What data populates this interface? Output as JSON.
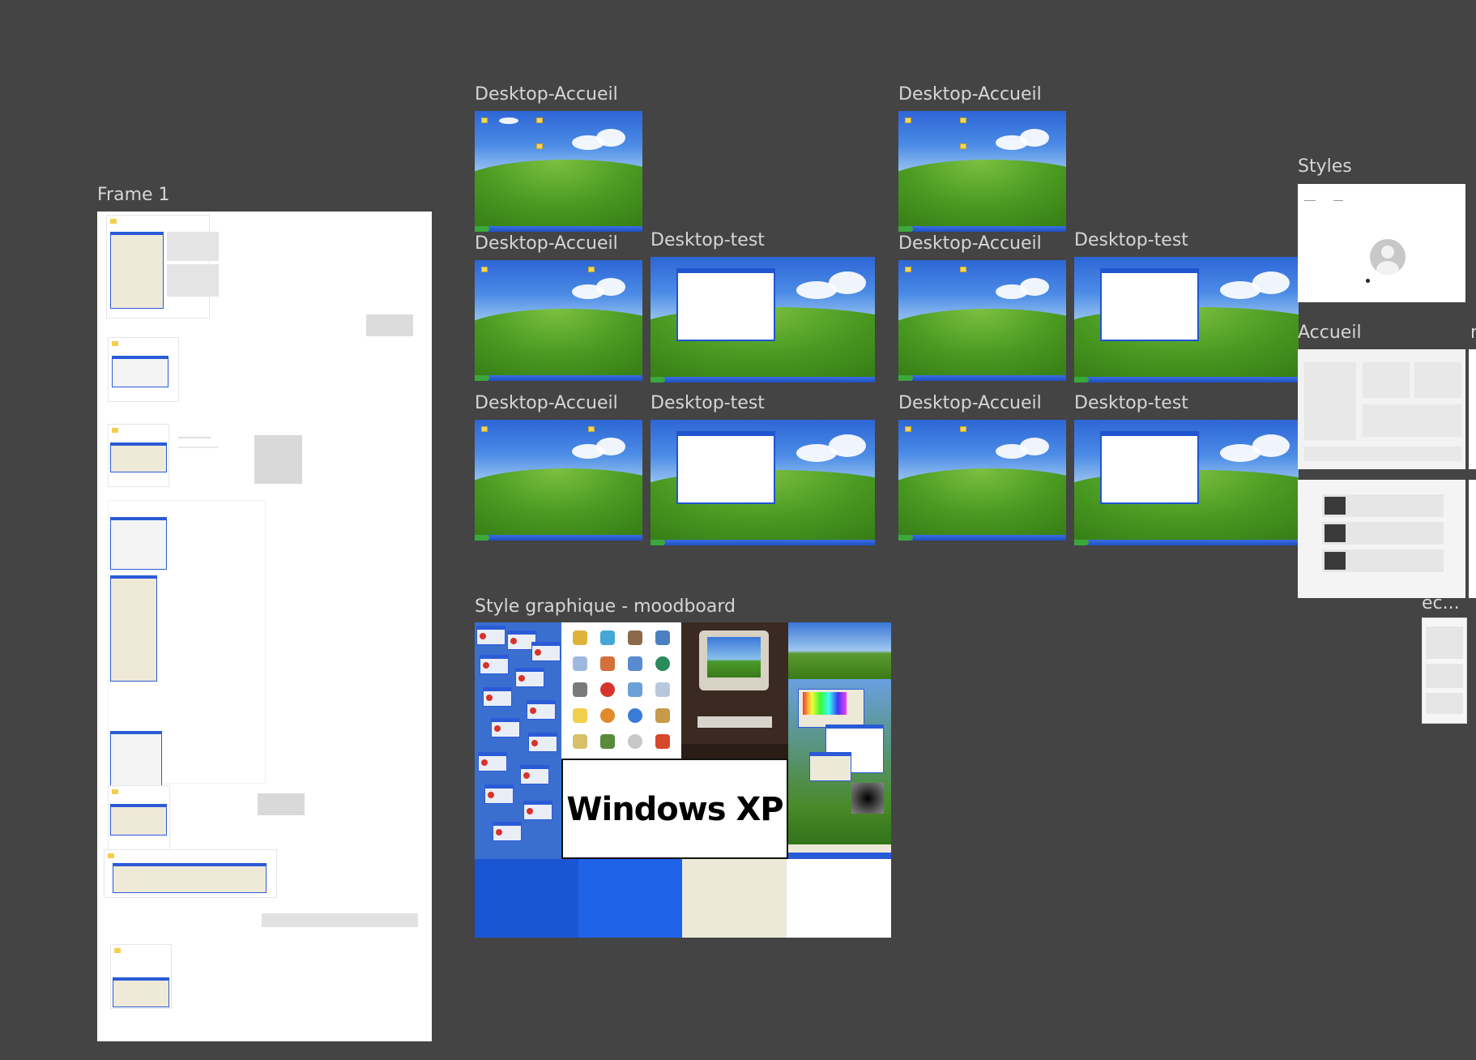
{
  "canvas": {
    "background": "#444444",
    "label_color": "#d6d6d6"
  },
  "frames": {
    "frame1": {
      "label": "Frame 1"
    },
    "styles": {
      "label": "Styles"
    },
    "accueil": {
      "label": "Accueil"
    },
    "truncated_r": {
      "label": "r"
    },
    "ec": {
      "label": "ec..."
    },
    "moodboard": {
      "label": "Style graphique - moodboard",
      "big_text": "Windows XP"
    }
  },
  "desktop_frames": {
    "c1r1": {
      "label": "Desktop-Accueil"
    },
    "c1r2": {
      "label": "Desktop-Accueil"
    },
    "c1r3": {
      "label": "Desktop-Accueil"
    },
    "c2r2": {
      "label": "Desktop-test"
    },
    "c2r3": {
      "label": "Desktop-test"
    },
    "c3r1": {
      "label": "Desktop-Accueil"
    },
    "c3r2": {
      "label": "Desktop-Accueil"
    },
    "c3r3": {
      "label": "Desktop-Accueil"
    },
    "c4r2": {
      "label": "Desktop-test"
    },
    "c4r3": {
      "label": "Desktop-test"
    }
  },
  "palette": {
    "xp_blue_dark": "#1a56d4",
    "xp_blue": "#1f63e8",
    "xp_beige": "#ece9d8",
    "white": "#ffffff"
  },
  "icons": [
    "folder-icon",
    "error-icon",
    "user-avatar-icon",
    "start-button-icon"
  ]
}
